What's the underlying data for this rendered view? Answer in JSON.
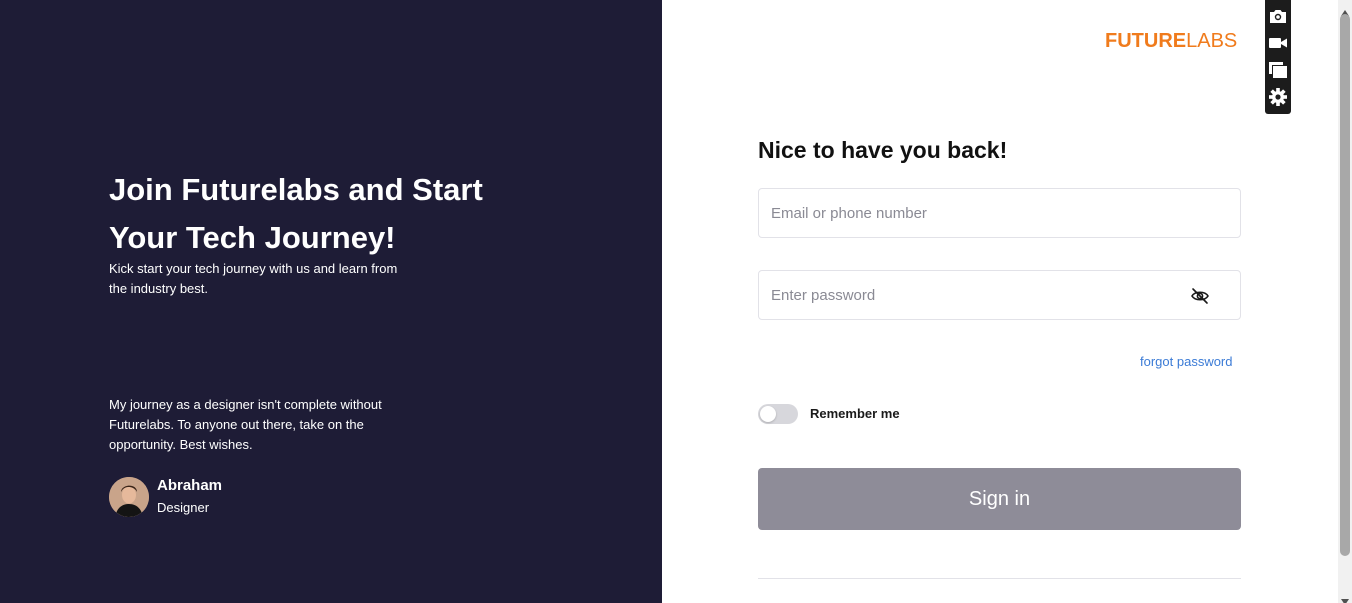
{
  "colors": {
    "left_panel_bg": "#1e1c36",
    "brand_orange": "#f07b1c",
    "link_blue": "#3b7bd6",
    "signin_button_bg": "#8e8c98"
  },
  "left_panel": {
    "title": "Join Futurelabs and Start Your Tech Journey!",
    "subtitle": "Kick start your tech journey with us and learn from the industry best.",
    "testimonial": {
      "quote": "My journey as a designer isn't complete without Futurelabs. To anyone out there, take on the opportunity. Best wishes.",
      "author_name": "Abraham",
      "author_role": "Designer"
    }
  },
  "logo": {
    "strong": "FUTURE",
    "light": "LABS"
  },
  "form": {
    "title": "Nice to have you back!",
    "email_placeholder": "Email or phone number",
    "email_value": "",
    "password_placeholder": "Enter password",
    "password_value": "",
    "password_toggle_icon": "eye-off-icon",
    "forgot_label": "forgot password",
    "remember_label": "Remember me",
    "remember_checked": false,
    "signin_label": "Sign in"
  },
  "toolbar": {
    "icons": [
      "camera-icon",
      "video-icon",
      "windows-icon",
      "gear-icon"
    ]
  }
}
